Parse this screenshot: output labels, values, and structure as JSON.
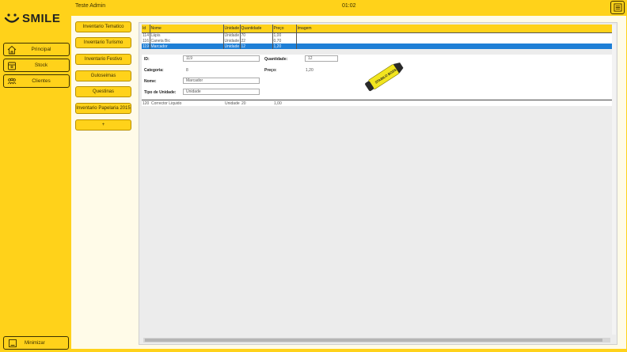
{
  "header": {
    "user": "Teste Admin",
    "time": "01:02"
  },
  "logo": {
    "text": "SMILE"
  },
  "nav": [
    {
      "label": "Principal",
      "icon": "home-icon"
    },
    {
      "label": "Stock",
      "icon": "box-icon"
    },
    {
      "label": "Clientes",
      "icon": "users-icon"
    }
  ],
  "minimize": {
    "label": "Minimizar"
  },
  "categories": [
    "Inventario Tematico",
    "Inventario Turismo",
    "Inventario Festivo",
    "Guloseimas",
    "Questinas",
    "Inventario Papelaria 2015",
    "+"
  ],
  "grid": {
    "columns": [
      "Id",
      "Nome",
      "Unidade",
      "Quantidade",
      "Preço",
      "Imagem"
    ],
    "rows": [
      {
        "id": "114",
        "nome": "Lápis",
        "unidade": "Unidade",
        "quantidade": "70",
        "preco": "1,00",
        "selected": false
      },
      {
        "id": "116",
        "nome": "Caneta Bic",
        "unidade": "Unidade",
        "quantidade": "22",
        "preco": "0,70",
        "selected": false
      },
      {
        "id": "119",
        "nome": "Marcador",
        "unidade": "Unidade",
        "quantidade": "12",
        "preco": "1,20",
        "selected": true
      }
    ],
    "row_after": {
      "id": "120",
      "nome": "Corrector Liquido",
      "unidade": "Unidade",
      "quantidade": "20",
      "preco": "1,00"
    }
  },
  "details": {
    "id_label": "ID:",
    "id_value": "119",
    "categoria_label": "Categoria:",
    "categoria_value": "8",
    "nome_label": "Nome:",
    "nome_value": "Marcador",
    "tipo_label": "Tipo de Unidade:",
    "tipo_value": "Unidade",
    "quantidade_label": "Quantidade:",
    "quantidade_value": "12",
    "preco_label": "Preço:",
    "preco_value": "1,20",
    "marker_text": "STABILO BOSS"
  }
}
